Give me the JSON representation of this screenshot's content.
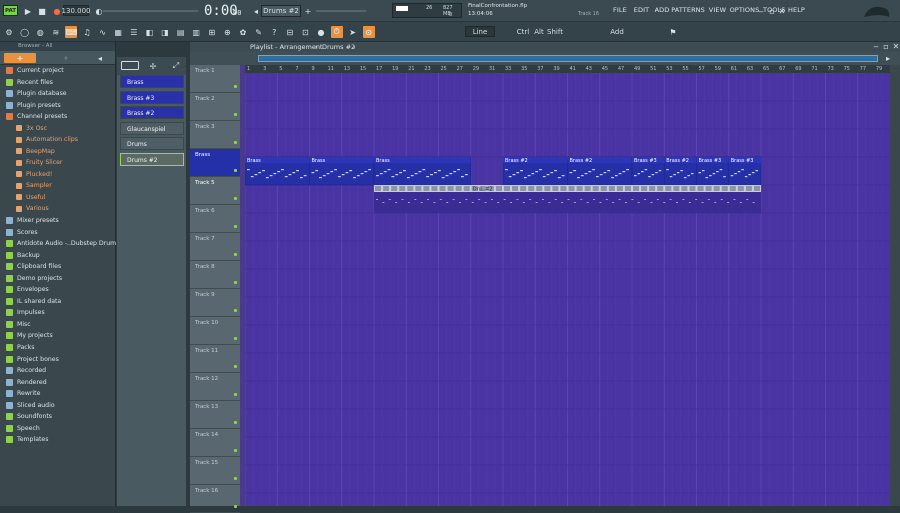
{
  "toolbar": {
    "pattern_mode": "PAT",
    "tempo": "130.000",
    "time_display": "0:00",
    "time_sub": "00",
    "pattern_name": "Drums #2",
    "memory": "827 MB",
    "cpu_value": "26",
    "cpu_second": "0",
    "file_name": "FinalConfrontation.flp",
    "file_time": "13:04:06",
    "hint": "Track 16",
    "menu": [
      "FILE",
      "EDIT",
      "ADD",
      "PATTERNS",
      "VIEW",
      "OPTIONS",
      "TOOLS",
      "HELP"
    ],
    "snap": "Line",
    "ctrl_labels": [
      "Ctrl",
      "Alt",
      "Shift",
      "Add"
    ]
  },
  "browser": {
    "header": "Browser - All",
    "items": [
      {
        "label": "Current project",
        "icon": "project-icon",
        "color": "#e07a4a"
      },
      {
        "label": "Recent files",
        "icon": "folder-icon",
        "color": "#8fd14f"
      },
      {
        "label": "Plugin database",
        "icon": "plugin-icon",
        "color": "#8fb2d1"
      },
      {
        "label": "Plugin presets",
        "icon": "plugin-icon",
        "color": "#8fb2d1"
      },
      {
        "label": "Channel presets",
        "icon": "folder-icon",
        "color": "#e07a4a"
      },
      {
        "label": "3x Osc",
        "icon": "sub-icon",
        "color": "#e6a36b",
        "sub": true
      },
      {
        "label": "Automation clips",
        "icon": "sub-icon",
        "color": "#e6a36b",
        "sub": true
      },
      {
        "label": "BeepMap",
        "icon": "sub-icon",
        "color": "#e6a36b",
        "sub": true
      },
      {
        "label": "Fruity Slicer",
        "icon": "sub-icon",
        "color": "#e6a36b",
        "sub": true
      },
      {
        "label": "Plucked!",
        "icon": "sub-icon",
        "color": "#e6a36b",
        "sub": true
      },
      {
        "label": "Sampler",
        "icon": "sub-icon",
        "color": "#e6a36b",
        "sub": true
      },
      {
        "label": "Useful",
        "icon": "sub-icon",
        "color": "#e6a36b",
        "sub": true
      },
      {
        "label": "Various",
        "icon": "sub-icon",
        "color": "#e6a36b",
        "sub": true
      },
      {
        "label": "Mixer presets",
        "icon": "mixer-icon",
        "color": "#8fb2d1"
      },
      {
        "label": "Scores",
        "icon": "note-icon",
        "color": "#8fb2d1"
      },
      {
        "label": "Antidote Audio -..Dubstep Drum Pack",
        "icon": "folder-icon",
        "color": "#8fd14f"
      },
      {
        "label": "Backup",
        "icon": "folder-icon",
        "color": "#8fd14f"
      },
      {
        "label": "Clipboard files",
        "icon": "folder-icon",
        "color": "#8fd14f"
      },
      {
        "label": "Demo projects",
        "icon": "folder-icon",
        "color": "#8fd14f"
      },
      {
        "label": "Envelopes",
        "icon": "folder-icon",
        "color": "#8fd14f"
      },
      {
        "label": "IL shared data",
        "icon": "folder-icon",
        "color": "#8fd14f"
      },
      {
        "label": "Impulses",
        "icon": "folder-icon",
        "color": "#8fd14f"
      },
      {
        "label": "Misc",
        "icon": "folder-icon",
        "color": "#8fd14f"
      },
      {
        "label": "My projects",
        "icon": "folder-icon",
        "color": "#8fd14f"
      },
      {
        "label": "Packs",
        "icon": "folder-icon",
        "color": "#8fd14f"
      },
      {
        "label": "Project bones",
        "icon": "folder-icon",
        "color": "#8fd14f"
      },
      {
        "label": "Recorded",
        "icon": "plus-icon",
        "color": "#8fb2d1"
      },
      {
        "label": "Rendered",
        "icon": "plus-icon",
        "color": "#8fb2d1"
      },
      {
        "label": "Rewrite",
        "icon": "plus-icon",
        "color": "#8fb2d1"
      },
      {
        "label": "Sliced audio",
        "icon": "plus-icon",
        "color": "#8fb2d1"
      },
      {
        "label": "Soundfonts",
        "icon": "folder-icon",
        "color": "#8fd14f"
      },
      {
        "label": "Speech",
        "icon": "folder-icon",
        "color": "#8fd14f"
      },
      {
        "label": "Templates",
        "icon": "folder-icon",
        "color": "#8fd14f"
      }
    ]
  },
  "channels": [
    {
      "label": "Brass",
      "selected": true
    },
    {
      "label": "Brass #3",
      "selected": true
    },
    {
      "label": "Brass #2",
      "selected": true
    },
    {
      "label": "Glaucanspiel",
      "selected": false
    },
    {
      "label": "Drums",
      "selected": false
    },
    {
      "label": "Drums #2",
      "selected": false,
      "active": true
    }
  ],
  "playlist": {
    "title": "Playlist - Arrangement",
    "pattern": "Drums #2",
    "ruler": [
      "1",
      "3",
      "5",
      "7",
      "9",
      "11",
      "13",
      "15",
      "17",
      "19",
      "21",
      "23",
      "25",
      "27",
      "29",
      "31",
      "33",
      "35",
      "37",
      "39",
      "41",
      "43",
      "45",
      "47",
      "49",
      "51",
      "53",
      "55",
      "57",
      "59",
      "61",
      "63",
      "65",
      "67",
      "69",
      "71",
      "73",
      "75",
      "77",
      "79"
    ],
    "tracks": [
      "Track 1",
      "Track 2",
      "Track 3",
      "Brass",
      "Track 5",
      "Track 6",
      "Track 7",
      "Track 8",
      "Track 9",
      "Track 10",
      "Track 11",
      "Track 12",
      "Track 13",
      "Track 14",
      "Track 15",
      "Track 16"
    ],
    "brass_clips": [
      {
        "label": "Brass",
        "bar": 1,
        "len": 8
      },
      {
        "label": "Brass",
        "bar": 9,
        "len": 8
      },
      {
        "label": "Brass",
        "bar": 17,
        "len": 12
      },
      {
        "label": "Brass #2",
        "bar": 33,
        "len": 8
      },
      {
        "label": "Brass #2",
        "bar": 41,
        "len": 8
      },
      {
        "label": "Brass #3",
        "bar": 49,
        "len": 4
      },
      {
        "label": "Brass #2",
        "bar": 53,
        "len": 4
      },
      {
        "label": "Brass #3",
        "bar": 57,
        "len": 4
      },
      {
        "label": "Brass #3",
        "bar": 61,
        "len": 4
      }
    ],
    "drum_clip": {
      "label": "Dru..#2",
      "bar": 29,
      "len": 4
    }
  }
}
